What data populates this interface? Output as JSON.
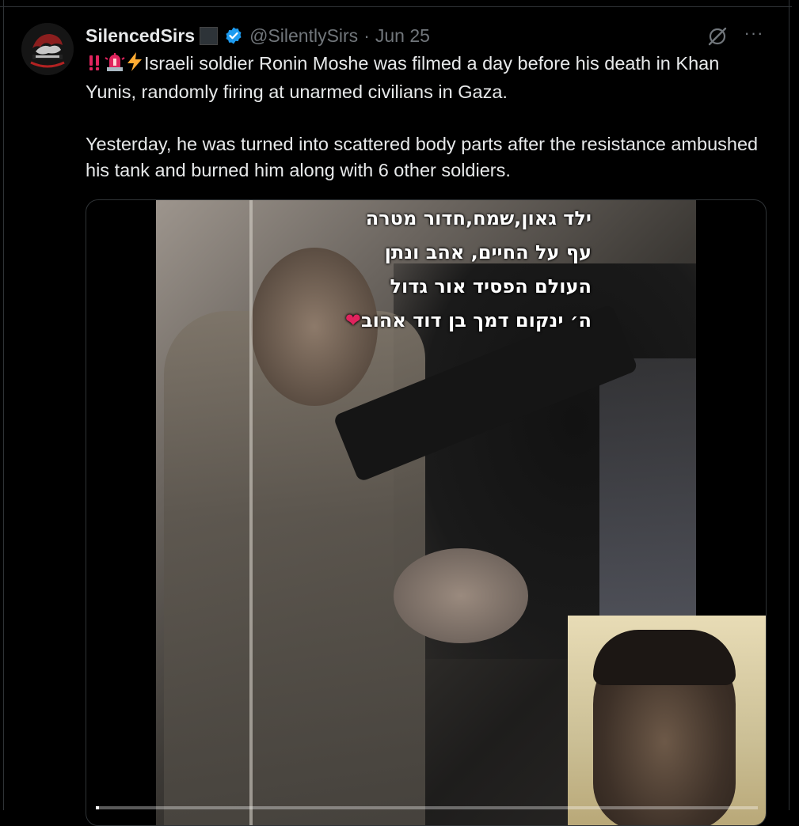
{
  "tweet": {
    "display_name": "SilencedSirs",
    "handle": "@SilentlySirs",
    "separator": "·",
    "date": "Jun 25",
    "more_label": "···",
    "paragraph1": "Israeli soldier Ronin Moshe was filmed a day before his death in Khan Yunis, randomly firing at unarmed civilians in Gaza.",
    "paragraph2": "Yesterday, he was turned into scattered body parts after the resistance ambushed his tank and burned him along with 6 other soldiers.",
    "leading_emojis": [
      "double-exclamation-emoji",
      "police-light-emoji",
      "lightning-emoji"
    ]
  },
  "media": {
    "overlay_lines": [
      "ילד גאון,שמח,חדור מטרה",
      "עף על החיים, אהב ונתן",
      "העולם הפסיד אור גדול",
      "ה׳ ינקום דמך בן דוד אהוב"
    ],
    "progress": 0.0
  },
  "colors": {
    "background": "#000000",
    "text_primary": "#e7e9ea",
    "text_secondary": "#71767b",
    "verified_blue": "#1d9bf0",
    "border": "#2f3336"
  },
  "icons": {
    "verified": "verified-badge-icon",
    "grok": "grok-icon",
    "more": "more-icon"
  }
}
